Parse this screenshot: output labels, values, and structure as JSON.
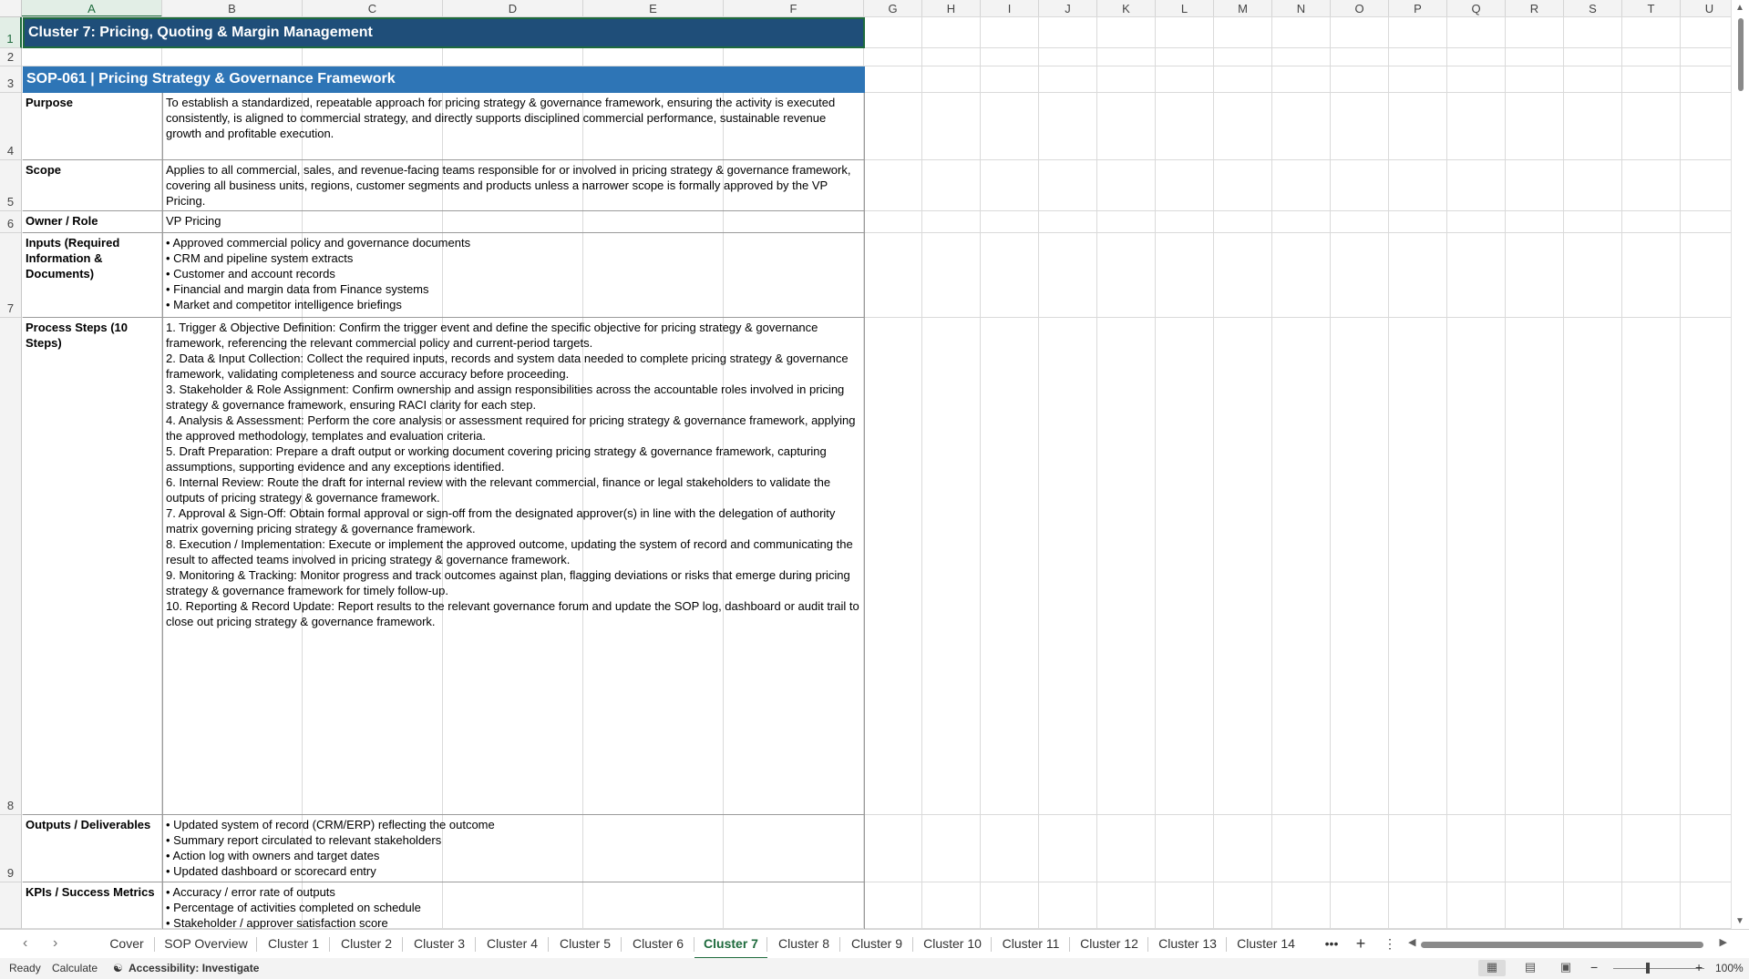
{
  "columns": [
    "A",
    "B",
    "C",
    "D",
    "E",
    "F",
    "G",
    "H",
    "I",
    "J",
    "K",
    "L",
    "M",
    "N",
    "O",
    "P",
    "Q",
    "R",
    "S",
    "T",
    "U"
  ],
  "rows": [
    "1",
    "2",
    "3",
    "4",
    "5",
    "6",
    "7",
    "8",
    "9"
  ],
  "sheet": {
    "title": "Cluster 7: Pricing, Quoting & Margin Management",
    "sop_header": "SOP-061  |  Pricing Strategy & Governance Framework",
    "fields": [
      {
        "label": "Purpose",
        "value": "To establish a standardized, repeatable approach for pricing strategy & governance framework, ensuring the activity is executed consistently, is aligned to commercial strategy, and directly supports disciplined commercial performance, sustainable revenue growth and profitable execution."
      },
      {
        "label": "Scope",
        "value": "Applies to all commercial, sales, and revenue-facing teams responsible for or involved in pricing strategy & governance framework, covering all business units, regions, customer segments and products unless a narrower scope is formally approved by the VP Pricing."
      },
      {
        "label": "Owner / Role",
        "value": "VP Pricing"
      },
      {
        "label": "Inputs (Required Information & Documents)",
        "value": "• Approved commercial policy and governance documents\n• CRM and pipeline system extracts\n• Customer and account records\n• Financial and margin data from Finance systems\n• Market and competitor intelligence briefings"
      },
      {
        "label": "Process Steps (10 Steps)",
        "value": "1. Trigger & Objective Definition: Confirm the trigger event and define the specific objective for pricing strategy & governance framework, referencing the relevant commercial policy and current-period targets.\n2. Data & Input Collection: Collect the required inputs, records and system data needed to complete pricing strategy & governance framework, validating completeness and source accuracy before proceeding.\n3. Stakeholder & Role Assignment: Confirm ownership and assign responsibilities across the accountable roles involved in pricing strategy & governance framework, ensuring RACI clarity for each step.\n4. Analysis & Assessment: Perform the core analysis or assessment required for pricing strategy & governance framework, applying the approved methodology, templates and evaluation criteria.\n5. Draft Preparation: Prepare a draft output or working document covering pricing strategy & governance framework, capturing assumptions, supporting evidence and any exceptions identified.\n6. Internal Review: Route the draft for internal review with the relevant commercial, finance or legal stakeholders to validate the outputs of pricing strategy & governance framework.\n7. Approval & Sign-Off: Obtain formal approval or sign-off from the designated approver(s) in line with the delegation of authority matrix governing pricing strategy & governance framework.\n8. Execution / Implementation: Execute or implement the approved outcome, updating the system of record and communicating the result to affected teams involved in pricing strategy & governance framework.\n9. Monitoring & Tracking: Monitor progress and track outcomes against plan, flagging deviations or risks that emerge during pricing strategy & governance framework for timely follow-up.\n10. Reporting & Record Update: Report results to the relevant governance forum and update the SOP log, dashboard or audit trail to close out pricing strategy & governance framework."
      },
      {
        "label": "Outputs / Deliverables",
        "value": "• Updated system of record (CRM/ERP) reflecting the outcome\n• Summary report circulated to relevant stakeholders\n• Action log with owners and target dates\n• Updated dashboard or scorecard entry"
      },
      {
        "label": "KPIs / Success Metrics",
        "value": "• Accuracy / error rate of outputs\n• Percentage of activities completed on schedule\n• Stakeholder / approver satisfaction score"
      }
    ]
  },
  "tabs": [
    "Cover",
    "SOP Overview",
    "Cluster 1",
    "Cluster 2",
    "Cluster 3",
    "Cluster 4",
    "Cluster 5",
    "Cluster 6",
    "Cluster 7",
    "Cluster 8",
    "Cluster 9",
    "Cluster 10",
    "Cluster 11",
    "Cluster 12",
    "Cluster 13",
    "Cluster 14"
  ],
  "active_tab": "Cluster 7",
  "tab_more": "•••",
  "tab_add": "+",
  "tab_menu": "⋮",
  "status": {
    "ready": "Ready",
    "calculate": "Calculate",
    "accessibility": "Accessibility: Investigate",
    "zoom": "100%",
    "zoom_minus": "−",
    "zoom_plus": "+"
  }
}
